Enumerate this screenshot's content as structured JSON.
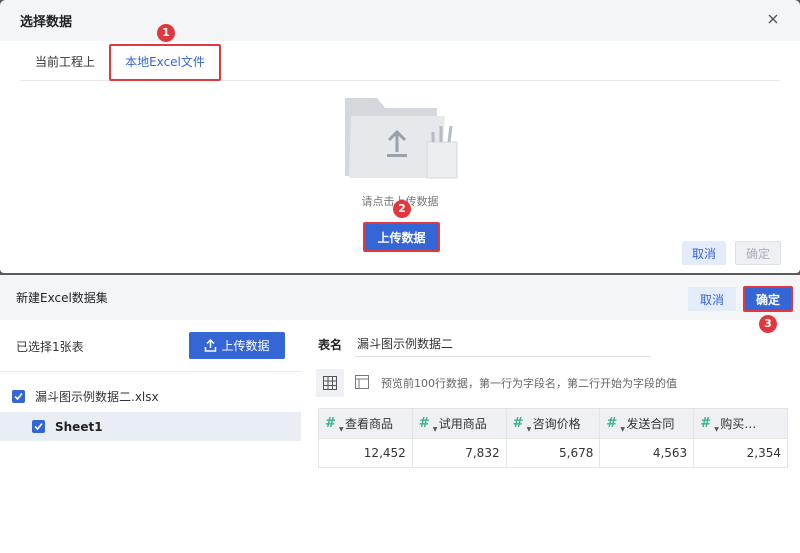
{
  "dialog1": {
    "title": "选择数据",
    "tabs": [
      {
        "label": "当前工程上"
      },
      {
        "label": "本地Excel文件"
      }
    ],
    "upload_hint": "请点击上传数据",
    "upload_button": "上传数据",
    "cancel_label": "取消",
    "ok_label": "确定"
  },
  "dialog2": {
    "title": "新建Excel数据集",
    "cancel_label": "取消",
    "ok_label": "确定",
    "selected_count": "已选择1张表",
    "upload_button": "上传数据",
    "file_name": "漏斗图示例数据二.xlsx",
    "sheet_name": "Sheet1",
    "table_name_label": "表名",
    "table_name_value": "漏斗图示例数据二",
    "preview_hint": "预览前100行数据，第一行为字段名，第二行开始为字段的值",
    "columns": [
      "查看商品",
      "试用商品",
      "咨询价格",
      "发送合同",
      "购买…"
    ],
    "rows": [
      [
        "12,452",
        "7,832",
        "5,678",
        "4,563",
        "2,354"
      ]
    ]
  },
  "badges": [
    "1",
    "2",
    "3"
  ],
  "colors": {
    "accent": "#3466d6",
    "highlight": "#e0383e",
    "numeric_type": "#3cb38a"
  }
}
